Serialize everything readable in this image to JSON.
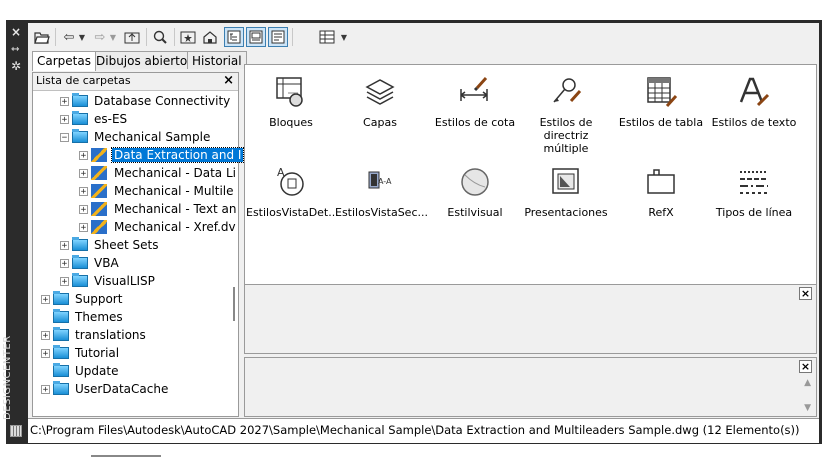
{
  "panel": {
    "vertical_title": "DESIGNCENTER",
    "close_glyph": "×",
    "auto_hide_glyph": "⇿",
    "properties_glyph": "✲"
  },
  "toolbar": {
    "icons": [
      "open-folder-icon",
      "back-icon",
      "dropdown-icon",
      "forward-icon",
      "dropdown-icon",
      "up-icon",
      "search-icon",
      "favorites-icon",
      "home-icon",
      "tree-toggle-icon",
      "preview-icon",
      "description-icon",
      "views-icon",
      "dropdown-icon"
    ]
  },
  "tabs": [
    {
      "label": "Carpetas",
      "active": true
    },
    {
      "label": "Dibujos abiertos",
      "active": false
    },
    {
      "label": "Historial",
      "active": false
    }
  ],
  "tree": {
    "header": "Lista de carpetas",
    "close": "×",
    "expand_glyph": "+",
    "collapse_glyph": "−",
    "items": [
      {
        "label": "Database Connectivity",
        "level": 1,
        "exp": "+",
        "icon": "folder"
      },
      {
        "label": "es-ES",
        "level": 1,
        "exp": "+",
        "icon": "folder"
      },
      {
        "label": "Mechanical Sample",
        "level": 1,
        "exp": "−",
        "icon": "folder"
      },
      {
        "label": "Data Extraction and I",
        "level": 2,
        "exp": "+",
        "icon": "dwg",
        "selected": true
      },
      {
        "label": "Mechanical - Data Li",
        "level": 2,
        "exp": "+",
        "icon": "dwg"
      },
      {
        "label": "Mechanical - Multile",
        "level": 2,
        "exp": "+",
        "icon": "dwg"
      },
      {
        "label": "Mechanical - Text an",
        "level": 2,
        "exp": "+",
        "icon": "dwg"
      },
      {
        "label": "Mechanical - Xref.dv",
        "level": 2,
        "exp": "+",
        "icon": "dwg"
      },
      {
        "label": "Sheet Sets",
        "level": 1,
        "exp": "+",
        "icon": "folder"
      },
      {
        "label": "VBA",
        "level": 1,
        "exp": "+",
        "icon": "folder"
      },
      {
        "label": "VisualLISP",
        "level": 1,
        "exp": "+",
        "icon": "folder"
      },
      {
        "label": "Support",
        "level": 0,
        "exp": "+",
        "icon": "folder"
      },
      {
        "label": "Themes",
        "level": 0,
        "exp": "",
        "icon": "folder"
      },
      {
        "label": "translations",
        "level": 0,
        "exp": "+",
        "icon": "folder"
      },
      {
        "label": "Tutorial",
        "level": 0,
        "exp": "+",
        "icon": "folder"
      },
      {
        "label": "Update",
        "level": 0,
        "exp": "",
        "icon": "folder"
      },
      {
        "label": "UserDataCache",
        "level": 0,
        "exp": "+",
        "icon": "folder"
      }
    ]
  },
  "content": {
    "items": [
      {
        "line1": "Bloques",
        "line2": "",
        "icon": "blocks-icon"
      },
      {
        "line1": "Capas",
        "line2": "",
        "icon": "layers-icon"
      },
      {
        "line1": "Estilos de cota",
        "line2": "",
        "icon": "dimstyle-icon"
      },
      {
        "line1": "Estilos de",
        "line2": "directriz múltiple",
        "icon": "mleader-icon"
      },
      {
        "line1": "Estilos de tabla",
        "line2": "",
        "icon": "tablestyle-icon"
      },
      {
        "line1": "Estilos de texto",
        "line2": "",
        "icon": "textstyle-icon"
      },
      {
        "line1": "EstilosVistaDet...",
        "line2": "",
        "icon": "detailview-icon"
      },
      {
        "line1": "EstilosVistaSec...",
        "line2": "",
        "icon": "sectionview-icon"
      },
      {
        "line1": "Estilvisual",
        "line2": "",
        "icon": "visualstyle-icon"
      },
      {
        "line1": "Presentaciones",
        "line2": "",
        "icon": "layouts-icon"
      },
      {
        "line1": "RefX",
        "line2": "",
        "icon": "xref-icon"
      },
      {
        "line1": "Tipos de línea",
        "line2": "",
        "icon": "linetype-icon"
      }
    ]
  },
  "preview_pane": {
    "close": "×"
  },
  "description_pane": {
    "close": "×",
    "up": "▲",
    "down": "▼"
  },
  "status": {
    "path": "C:\\Program Files\\Autodesk\\AutoCAD 2027\\Sample\\Mechanical Sample\\Data Extraction and Multileaders Sample.dwg (12 Elemento(s))"
  }
}
